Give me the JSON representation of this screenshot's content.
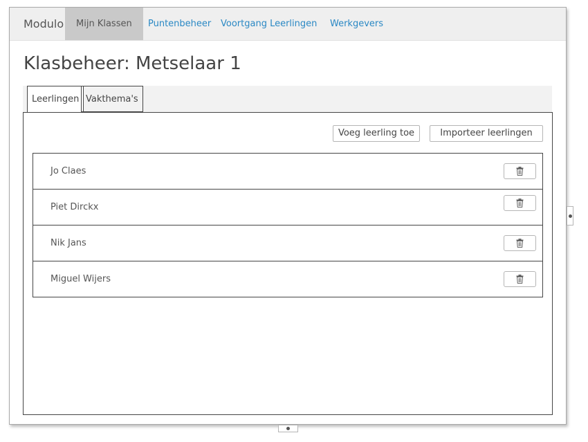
{
  "navbar": {
    "brand": "Modulo",
    "items": [
      {
        "label": "Mijn Klassen",
        "active": true
      },
      {
        "label": "Puntenbeheer",
        "active": false
      },
      {
        "label": "Voortgang Leerlingen",
        "active": false
      },
      {
        "label": "Werkgevers",
        "active": false
      }
    ]
  },
  "page": {
    "title": "Klasbeheer: Metselaar 1"
  },
  "tabs": [
    {
      "label": "Leerlingen",
      "active": true
    },
    {
      "label": "Vakthema's",
      "active": false
    }
  ],
  "toolbar": {
    "add_label": "Voeg leerling toe",
    "import_label": "Importeer leerlingen"
  },
  "students": [
    {
      "name": "Jo Claes"
    },
    {
      "name": "Piet Dirckx"
    },
    {
      "name": "Nik Jans"
    },
    {
      "name": "Miguel Wijers"
    }
  ],
  "icons": {
    "delete": "trash-icon"
  },
  "colors": {
    "link": "#2a88c4",
    "nav_active_bg": "#c9c9c9",
    "navbar_bg": "#efefef",
    "border": "#444444"
  }
}
